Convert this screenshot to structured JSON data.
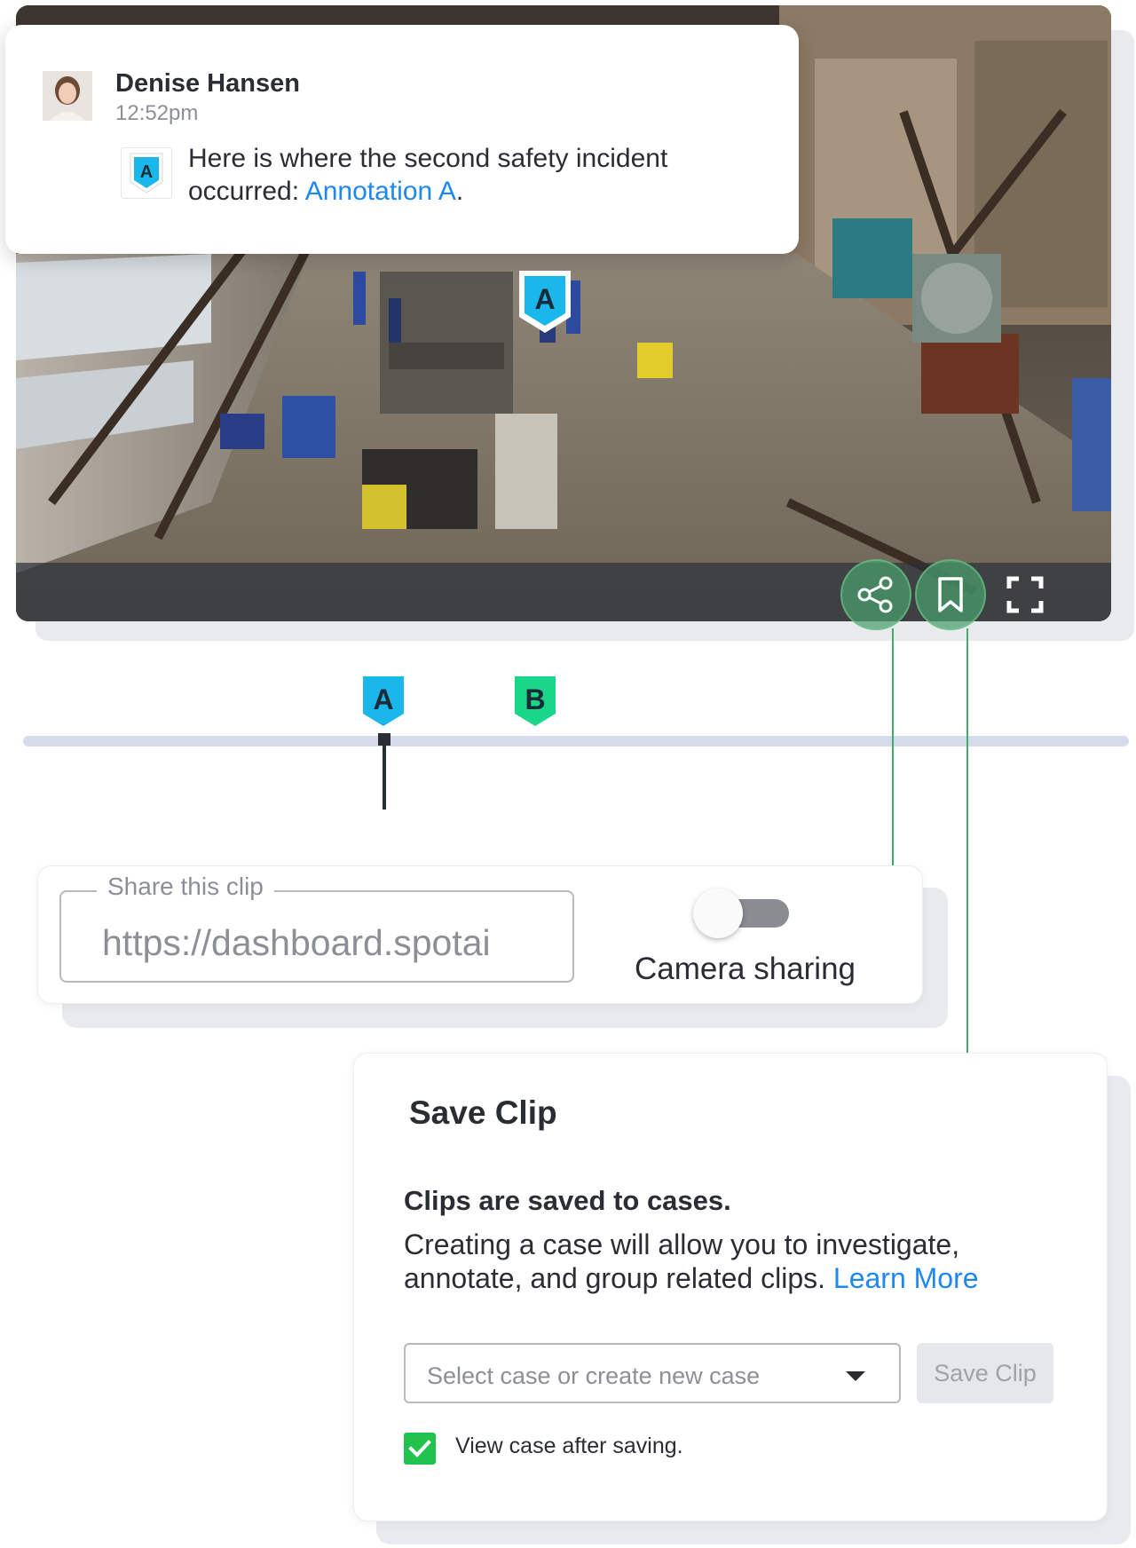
{
  "colors": {
    "accent_link": "#1e87f0",
    "marker_a": "#1ab8ea",
    "marker_b": "#19d68a",
    "connector": "#3fae68",
    "checkbox": "#22c34d",
    "text": "#2b2d35",
    "muted": "#8c8f96"
  },
  "video": {
    "marker_label": "A",
    "controls": {
      "share_icon": "share-icon",
      "bookmark_icon": "bookmark-icon",
      "fullscreen_icon": "fullscreen-icon"
    }
  },
  "chat": {
    "author": "Denise Hansen",
    "time": "12:52pm",
    "badge_label": "A",
    "message": "Here is where the second safety incident occurred: ",
    "link_text": "Annotation A",
    "message_end": "."
  },
  "timeline": {
    "markers": [
      {
        "label": "A",
        "color": "#1ab8ea"
      },
      {
        "label": "B",
        "color": "#19d68a"
      }
    ]
  },
  "share": {
    "legend": "Share this clip",
    "url": "https://dashboard.spotai",
    "toggle_label": "Camera sharing",
    "toggle_on": false
  },
  "save_clip": {
    "title": "Save Clip",
    "subtitle": "Clips are saved to cases.",
    "body": "Creating a case will allow you to investigate, annotate, and group related clips. ",
    "learn_more": "Learn More",
    "select_placeholder": "Select case or create new case",
    "save_button": "Save Clip",
    "checkbox_label": "View case after saving.",
    "checkbox_checked": true
  }
}
